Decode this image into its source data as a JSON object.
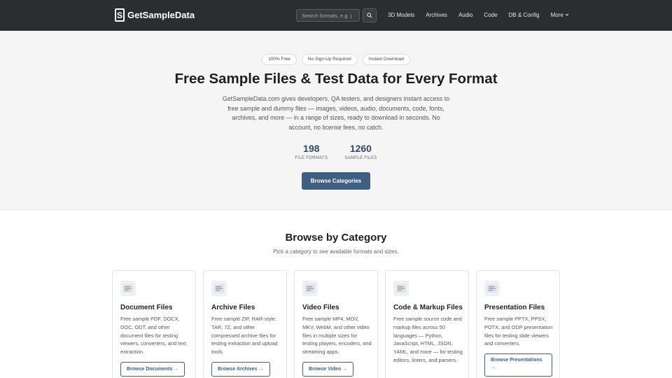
{
  "nav": {
    "logo_letter": "S",
    "brand": "GetSampleData",
    "search_placeholder": "Search formats, e.g. j",
    "links": [
      "3D Models",
      "Archives",
      "Audio",
      "Code",
      "DB & Config",
      "More"
    ]
  },
  "hero": {
    "badges": [
      "100% Free",
      "No Sign-Up Required",
      "Instant Download"
    ],
    "title": "Free Sample Files & Test Data for Every Format",
    "description": "GetSampleData.com gives developers, QA testers, and designers instant access to free sample and dummy files — images, videos, audio, documents, code, fonts, archives, and more — in a range of sizes, ready to download in seconds. No account, no license fees, no catch.",
    "stats": [
      {
        "value": "198",
        "label": "FILE FORMATS"
      },
      {
        "value": "1260",
        "label": "SAMPLE FILES"
      }
    ],
    "cta": "Browse Categories"
  },
  "categories": {
    "title": "Browse by Category",
    "subtitle": "Pick a category to see available formats and sizes.",
    "cards": [
      {
        "icon": "document-icon",
        "title": "Document Files",
        "description": "Free sample PDF, DOCX, DOC, ODT, and other document files for testing viewers, converters, and text extraction.",
        "button": "Browse Documents →"
      },
      {
        "icon": "archive-icon",
        "title": "Archive Files",
        "description": "Free sample ZIP, RAR-style, TAR, 7Z, and other compressed archive files for testing extraction and upload tools.",
        "button": "Browse Archives →"
      },
      {
        "icon": "video-icon",
        "title": "Video Files",
        "description": "Free sample MP4, MOV, MKV, WebM, and other video files in multiple sizes for testing players, encoders, and streaming apps.",
        "button": "Browse Video →"
      },
      {
        "icon": "code-icon",
        "title": "Code & Markup Files",
        "description": "Free sample source code and markup files across 50 languages — Python, JavaScript, HTML, JSON, YAML, and more — for testing editors, linters, and parsers.",
        "button": ""
      },
      {
        "icon": "presentation-icon",
        "title": "Presentation Files",
        "description": "Free sample PPTX, PPSX, POTX, and ODP presentation files for testing slide viewers and converters.",
        "button": "Browse Presentations →"
      }
    ]
  },
  "colors": {
    "navbar": "#2b2d31",
    "accent": "#3e5e82",
    "stat": "#2f4a6b",
    "hero_bg": "#f5f5f6"
  }
}
